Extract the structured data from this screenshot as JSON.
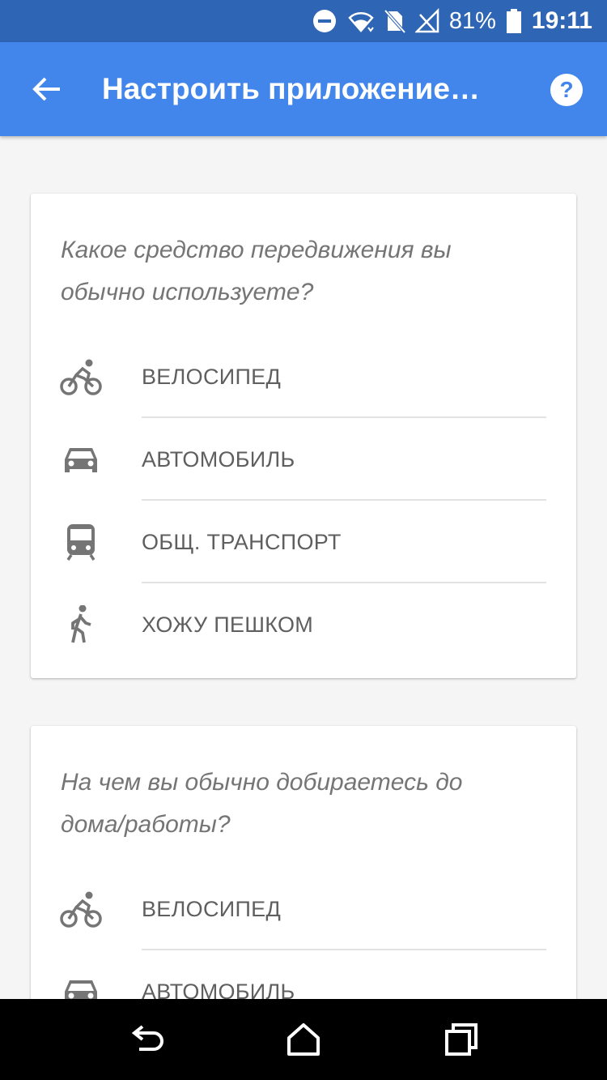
{
  "status_bar": {
    "battery_percent": "81%",
    "time": "19:11",
    "icons": [
      "dnd-icon",
      "wifi-icon",
      "no-sim-icon",
      "no-signal-icon",
      "battery-icon"
    ]
  },
  "app_bar": {
    "title": "Настроить приложение…",
    "icons": [
      "arrow-back-icon",
      "help-icon"
    ]
  },
  "cards": [
    {
      "question": "Какое средство передвижения вы обычно используете?",
      "options": [
        {
          "icon": "bike-icon",
          "label": "ВЕЛОСИПЕД"
        },
        {
          "icon": "car-icon",
          "label": "АВТОМОБИЛЬ"
        },
        {
          "icon": "transit-icon",
          "label": "ОБЩ. ТРАНСПОРТ"
        },
        {
          "icon": "walk-icon",
          "label": "ХОЖУ ПЕШКОМ"
        }
      ]
    },
    {
      "question": "На чем вы обычно добираетесь до дома/работы?",
      "options": [
        {
          "icon": "bike-icon",
          "label": "ВЕЛОСИПЕД"
        },
        {
          "icon": "car-icon",
          "label": "АВТОМОБИЛЬ"
        }
      ]
    }
  ],
  "nav_bar": {
    "icons": [
      "nav-back-icon",
      "nav-home-icon",
      "nav-recents-icon"
    ]
  },
  "colors": {
    "status_bar": "#2f65b5",
    "app_bar": "#4286ec",
    "background": "#f5f5f5",
    "text_secondary": "#757575",
    "icon_grey": "#757575"
  }
}
